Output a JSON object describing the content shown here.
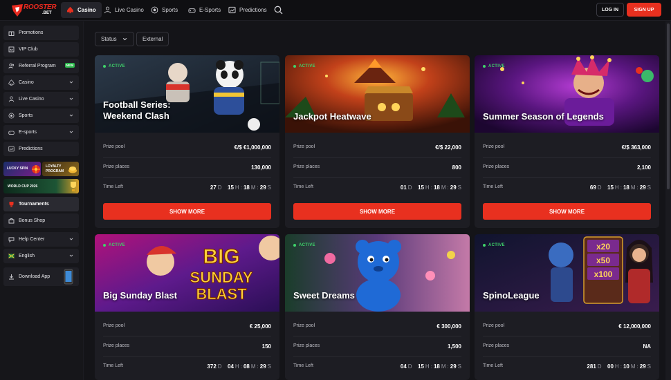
{
  "brand": {
    "name_main": "ROOSTER",
    "name_sub": ".BET",
    "accent": "#e8301f"
  },
  "nav": {
    "tabs": [
      {
        "label": "Casino",
        "icon": "spade-icon",
        "active": true
      },
      {
        "label": "Live Casino",
        "icon": "person-icon",
        "active": false
      },
      {
        "label": "Sports",
        "icon": "ball-icon",
        "active": false
      },
      {
        "label": "E-Sports",
        "icon": "gamepad-icon",
        "active": false
      },
      {
        "label": "Predictions",
        "icon": "chart-icon",
        "active": false
      }
    ],
    "login_label": "LOG IN",
    "signup_label": "SIGN UP"
  },
  "sidebar": {
    "items": [
      {
        "label": "Promotions",
        "icon": "gift-icon"
      },
      {
        "label": "VIP Club",
        "icon": "crown-icon"
      },
      {
        "label": "Referral Program",
        "icon": "users-icon",
        "badge": "NEW"
      },
      {
        "label": "Casino",
        "icon": "spade-icon",
        "chevron": true
      },
      {
        "label": "Live Casino",
        "icon": "person-icon",
        "chevron": true
      },
      {
        "label": "Sports",
        "icon": "ball-icon",
        "chevron": true
      },
      {
        "label": "E-sports",
        "icon": "gamepad-icon",
        "chevron": true
      },
      {
        "label": "Predictions",
        "icon": "chart-icon"
      },
      {
        "label": "Tournaments",
        "icon": "trophy-icon",
        "active": true
      },
      {
        "label": "Bonus Shop",
        "icon": "shop-icon"
      },
      {
        "label": "Help Center",
        "icon": "help-icon",
        "chevron": true
      },
      {
        "label": "English",
        "icon": "flag-icon",
        "chevron": true
      },
      {
        "label": "Download App",
        "icon": "download-icon"
      }
    ],
    "promos": {
      "lucky_spin": "LUCKY SPIN",
      "loyalty_1": "LOYALTY",
      "loyalty_2": "PROGRAM",
      "world_cup": "WORLD CUP 2026"
    }
  },
  "filters": {
    "status_label": "Status",
    "external_label": "External"
  },
  "labels": {
    "active": "ACTIVE",
    "prize_pool": "Prize pool",
    "prize_places": "Prize places",
    "time_left": "Time Left",
    "show_more": "SHOW MORE",
    "unit_d": "D",
    "unit_h": "H",
    "unit_m": "M",
    "unit_s": "S",
    "sep": ":"
  },
  "tournaments": [
    {
      "title_1": "Football Series:",
      "title_2": "Weekend Clash",
      "prize_pool": "€/$ €1,000,000",
      "prize_places": "130,000",
      "d": "27",
      "h": "15",
      "m": "18",
      "s": "29"
    },
    {
      "title_1": "Jackpot Heatwave",
      "title_2": "",
      "prize_pool": "€/$ 22,000",
      "prize_places": "800",
      "d": "01",
      "h": "15",
      "m": "18",
      "s": "29"
    },
    {
      "title_1": "Summer Season of Legends",
      "title_2": "",
      "prize_pool": "€/$ 363,000",
      "prize_places": "2,100",
      "d": "69",
      "h": "15",
      "m": "18",
      "s": "29"
    },
    {
      "title_1": "Big Sunday Blast",
      "title_2": "",
      "prize_pool": "€ 25,000",
      "prize_places": "150",
      "d": "372",
      "h": "04",
      "m": "08",
      "s": "29"
    },
    {
      "title_1": "Sweet Dreams",
      "title_2": "",
      "prize_pool": "€ 300,000",
      "prize_places": "1,500",
      "d": "04",
      "h": "15",
      "m": "18",
      "s": "29"
    },
    {
      "title_1": "SpinoLeague",
      "title_2": "",
      "prize_pool": "€ 12,000,000",
      "prize_places": "NA",
      "d": "281",
      "h": "00",
      "m": "10",
      "s": "29"
    }
  ],
  "banner_art": {
    "big_sunday": [
      "BIG",
      "SUNDAY",
      "BLAST"
    ],
    "spino_multipliers": [
      "x20",
      "x50",
      "x100"
    ]
  }
}
